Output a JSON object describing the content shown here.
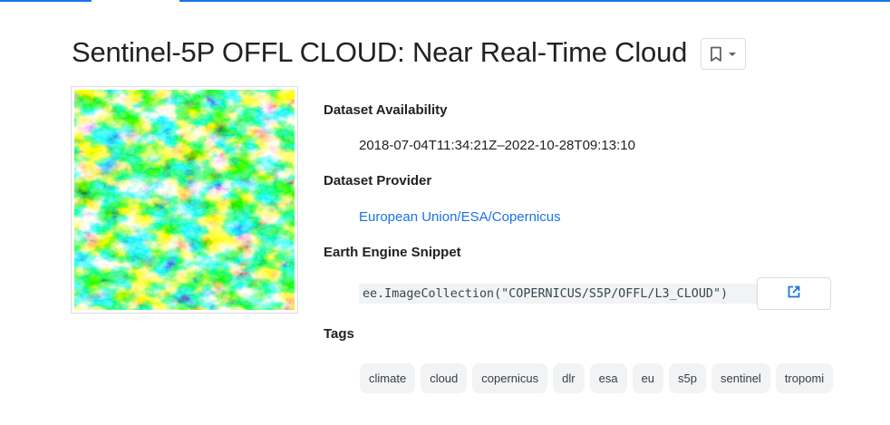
{
  "page": {
    "title": "Sentinel-5P OFFL CLOUD: Near Real-Time Cloud"
  },
  "dataset": {
    "availability_label": "Dataset Availability",
    "availability_value": "2018-07-04T11:34:21Z–2022-10-28T09:13:10",
    "provider_label": "Dataset Provider",
    "provider_value": "European Union/ESA/Copernicus",
    "snippet_label": "Earth Engine Snippet",
    "snippet_code": "ee.ImageCollection(\"COPERNICUS/S5P/OFFL/L3_CLOUD\")",
    "tags_label": "Tags",
    "tags": [
      "climate",
      "cloud",
      "copernicus",
      "dlr",
      "esa",
      "eu",
      "s5p",
      "sentinel",
      "tropomi"
    ]
  },
  "icons": {
    "bookmark": "bookmark-icon",
    "dropdown": "arrow-drop-down-icon",
    "open_in_new": "open-in-new-icon"
  },
  "colors": {
    "accent": "#1a73e8",
    "text": "#202124",
    "chip_bg": "#f1f3f4",
    "border": "#dadce0"
  }
}
